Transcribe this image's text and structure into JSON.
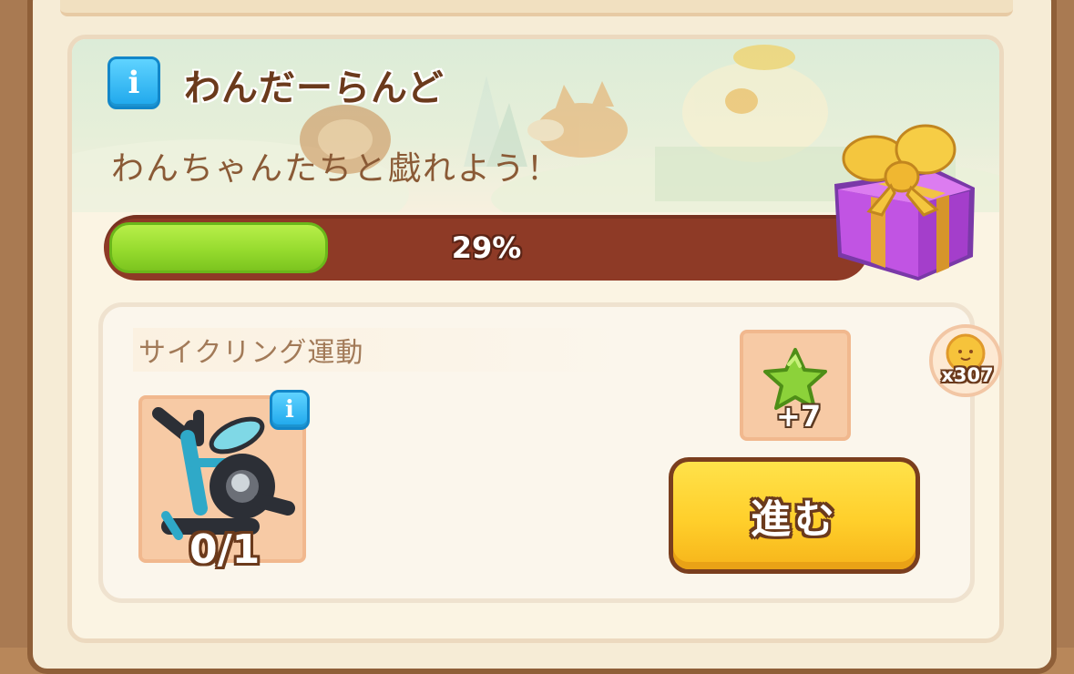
{
  "event": {
    "title": "わんだーらんど",
    "subtitle": "わんちゃんたちと戯れよう！",
    "progress_percent": 29,
    "progress_label": "29%"
  },
  "task": {
    "name": "サイクリング運動",
    "item_icon": "exercise-bike-icon",
    "item_count": "0/1",
    "reward_icon": "green-star-icon",
    "reward_amount": "+7",
    "go_label": "進む"
  },
  "currency": {
    "icon": "sun-coin-icon",
    "count": "x307"
  },
  "info_glyph": "i",
  "colors": {
    "progress_fill": "#93d92c",
    "progress_track": "#8e3a26",
    "go_button": "#ffcf2b",
    "title": "#6b3a1c",
    "info": "#1ea7ec"
  }
}
